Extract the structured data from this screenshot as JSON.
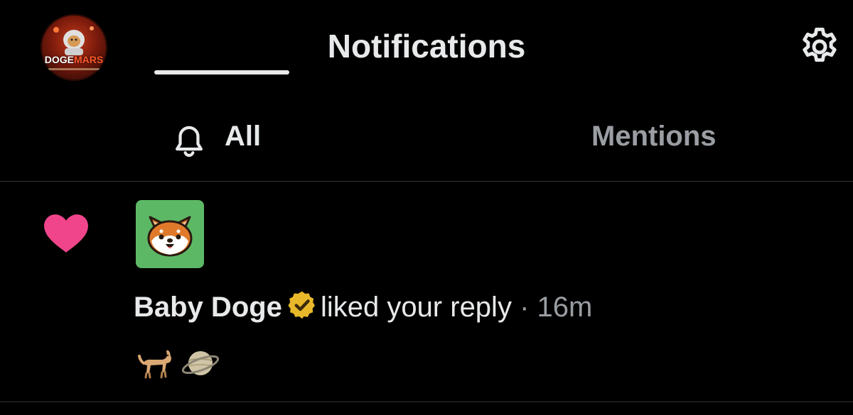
{
  "header": {
    "title": "Notifications",
    "avatar_text_left": "DOGE",
    "avatar_text_right": "MARS",
    "settings_icon": "gear-icon"
  },
  "tabs": [
    {
      "label": "All",
      "icon": "bell-icon",
      "active": true
    },
    {
      "label": "Mentions",
      "active": false
    }
  ],
  "notification": {
    "type_icon": "heart-icon",
    "type_color": "#f0458a",
    "actor_name": "Baby Doge",
    "verified_color": "#e8b82a",
    "action": "liked your reply",
    "separator": "·",
    "time": "16m",
    "reply_emojis": [
      "dog-emoji",
      "ringed-planet-emoji"
    ]
  }
}
